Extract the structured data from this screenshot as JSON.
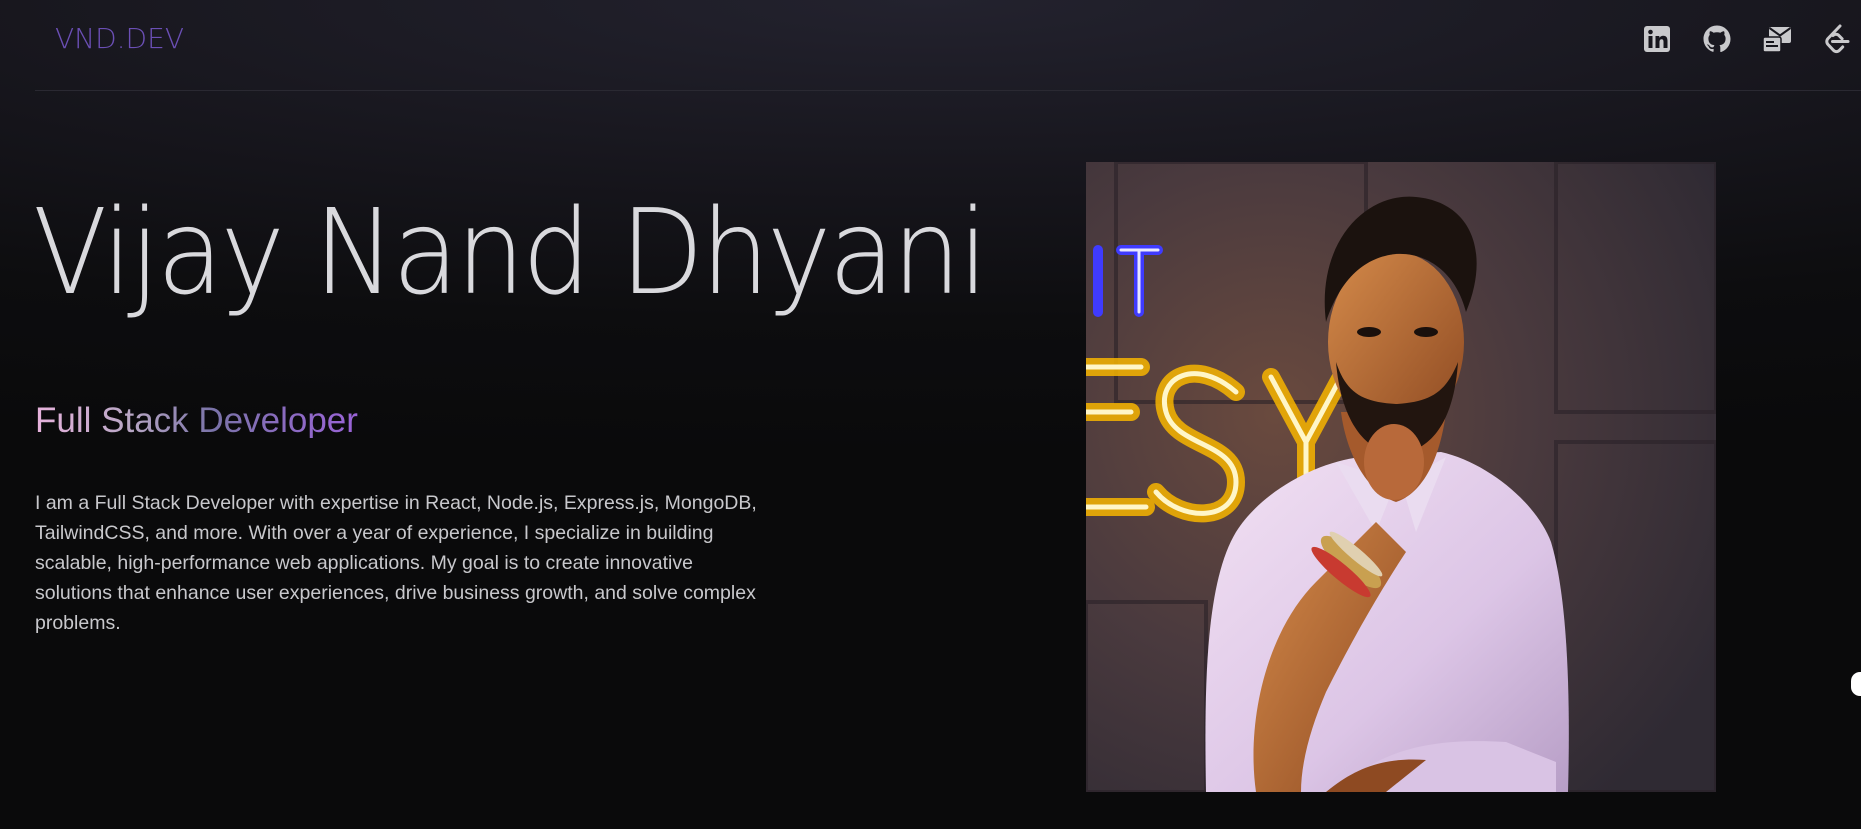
{
  "navbar": {
    "logo": "VND.DEV",
    "icons": [
      {
        "name": "linkedin-icon"
      },
      {
        "name": "github-icon"
      },
      {
        "name": "mail-icon"
      },
      {
        "name": "leetcode-icon"
      }
    ]
  },
  "hero": {
    "name": "Vijay Nand Dhyani",
    "role": "Full Stack Developer",
    "bio": "I am a Full Stack Developer with expertise in React, Node.js, Express.js, MongoDB, TailwindCSS, and more. With over a year of experience, I specialize in building scalable, high-performance web applications. My goal is to create innovative solutions that enhance user experiences, drive business growth, and solve complex problems."
  },
  "photo": {
    "neon_text_top": "IT",
    "neon_text_main": "ESY"
  },
  "colors": {
    "background": "#0b0b0c",
    "logo": "#6b4fb5",
    "name_text": "#d9d9dd",
    "bio_text": "#c8c8cc",
    "role_gradient_start": "#e7b3dd",
    "role_gradient_end": "#9a63d8",
    "icon": "#c9c9cc"
  }
}
